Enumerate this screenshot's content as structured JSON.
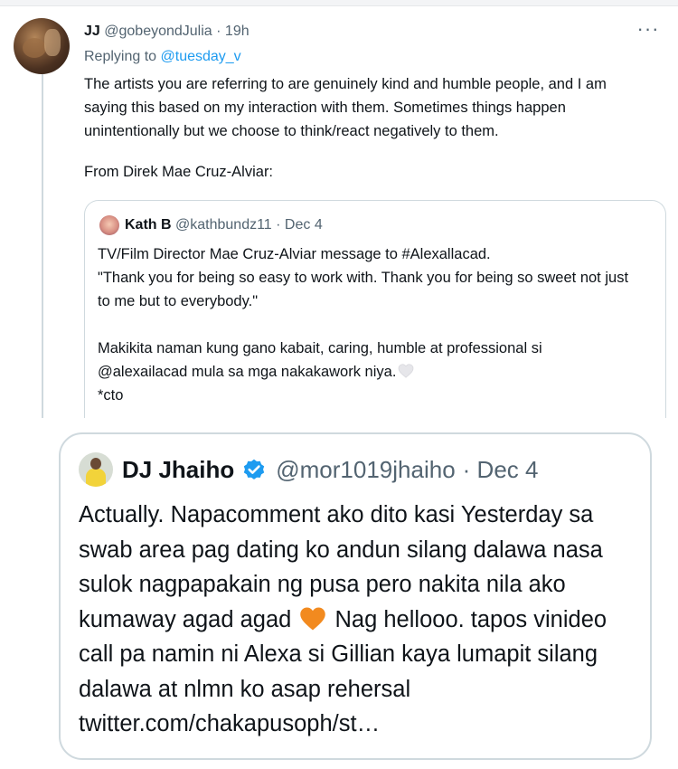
{
  "main_tweet": {
    "name": "JJ",
    "handle": "@gobeyondJulia",
    "time": "· 19h",
    "more": "···",
    "replying_prefix": "Replying to ",
    "replying_to": "@tuesday_v",
    "body": "The artists you are referring to are genuinely kind and humble people, and I am saying this based on my interaction with them. Sometimes things happen unintentionally but we choose to think/react negatively to them.",
    "from_line": "From Direk Mae Cruz-Alviar:"
  },
  "quoted_tweet": {
    "name": "Kath B",
    "handle": "@kathbundz11",
    "date": "· Dec 4",
    "para1": "TV/Film Director Mae Cruz-Alviar message to #Alexallacad.\n\"Thank you for being so easy to work with. Thank you for being so sweet not just to me but to everybody.\"",
    "para2": "Makikita naman kung gano kabait, caring, humble at professional si\n@alexailacad mula sa mga nakakawork niya.",
    "para3": "*cto"
  },
  "embedded_tweet": {
    "name": "DJ Jhaiho",
    "handle": "@mor1019jhaiho",
    "date": "· Dec 4",
    "body_part1": "Actually. Napacomment ako dito kasi Yesterday sa swab area pag dating ko andun silang dalawa nasa sulok nagpapakain ng pusa pero nakita nila ako kumaway agad agad",
    "body_part2": "Nag hellooo. tapos vinideo call pa namin ni Alexa si Gillian kaya lumapit silang dalawa at nlmn ko asap rehersal twitter.com/chakapusoph/st…"
  },
  "icons": {
    "white_heart": "white-heart-icon",
    "orange_heart": "orange-heart-icon",
    "verified": "verified-badge-icon"
  },
  "colors": {
    "link": "#1d9bf0",
    "text": "#0f1419",
    "muted": "#536471",
    "border": "#cfd9de",
    "heart_orange": "#f28a1f"
  }
}
